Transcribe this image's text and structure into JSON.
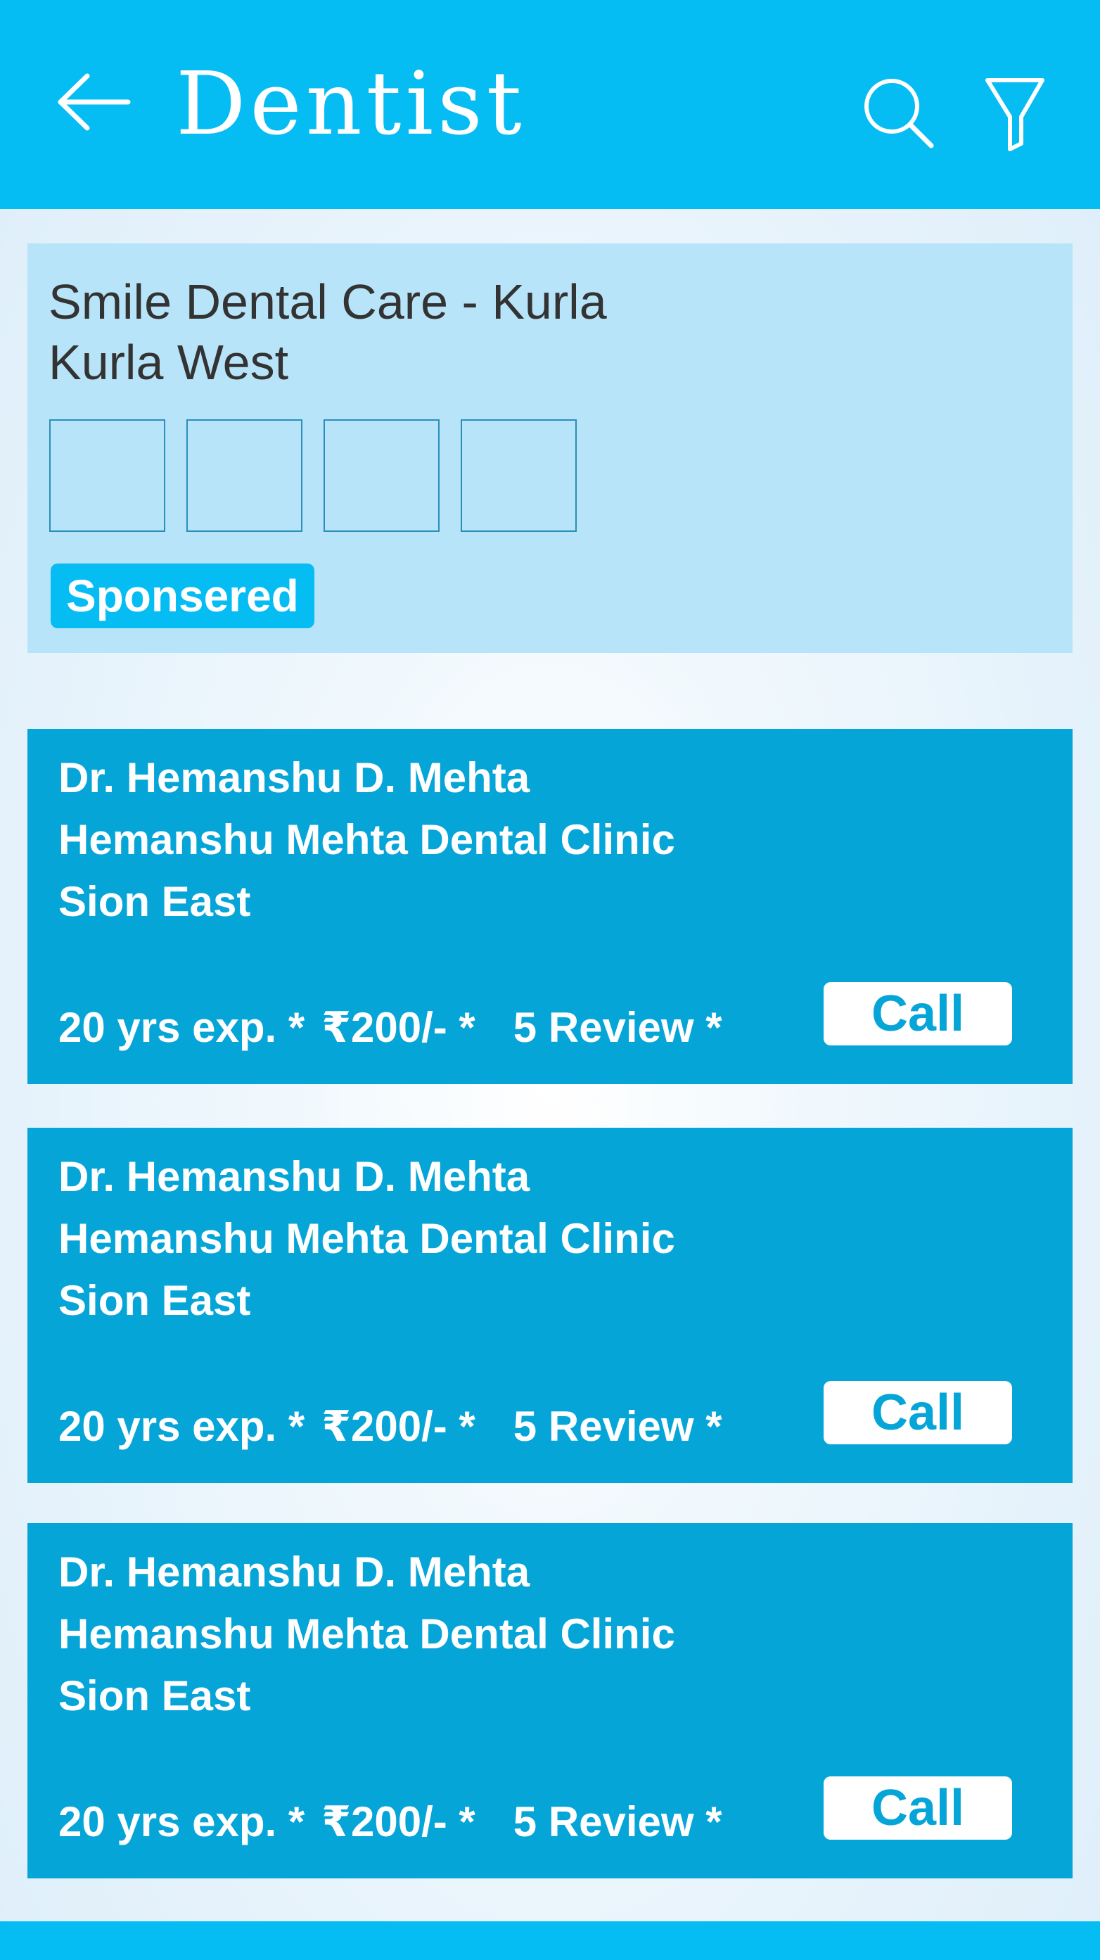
{
  "header": {
    "title": "Dentist",
    "back_icon": "arrow-left-icon",
    "search_icon": "search-icon",
    "filter_icon": "filter-icon",
    "color": "#06bdf3"
  },
  "sponsored": {
    "name": "Smile Dental Care - Kurla",
    "location": "Kurla West",
    "badge": "Sponsered",
    "background": "#b8e4f9"
  },
  "doctors": [
    {
      "name": "Dr. Hemanshu D. Mehta",
      "clinic": "Hemanshu Mehta Dental Clinic",
      "area": "Sion East",
      "experience": "20 yrs exp. *",
      "fee": "₹200/- *",
      "reviews": "5 Review *",
      "call_label": "Call"
    },
    {
      "name": "Dr. Hemanshu D. Mehta",
      "clinic": "Hemanshu Mehta Dental Clinic",
      "area": "Sion East",
      "experience": "20 yrs exp. *",
      "fee": "₹200/- *",
      "reviews": "5 Review *",
      "call_label": "Call"
    },
    {
      "name": "Dr. Hemanshu D. Mehta",
      "clinic": "Hemanshu Mehta Dental Clinic",
      "area": "Sion East",
      "experience": "20 yrs exp. *",
      "fee": "₹200/- *",
      "reviews": "5 Review *",
      "call_label": "Call"
    }
  ],
  "colors": {
    "card": "#06a5d8",
    "accent": "#06bdf3"
  }
}
